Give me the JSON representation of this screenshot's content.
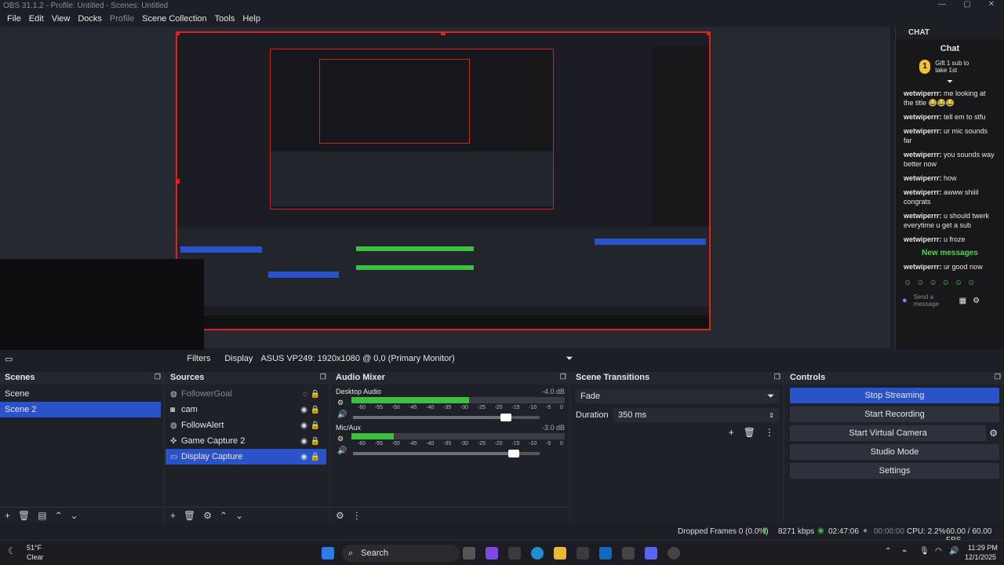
{
  "window": {
    "title": "OBS 31.1.2 - Profile: Untitled - Scenes: Untitled",
    "controls": [
      "—",
      "▢",
      "✕"
    ]
  },
  "menu": [
    "File",
    "Edit",
    "View",
    "Docks",
    "Profile",
    "Scene Collection",
    "Tools",
    "Help"
  ],
  "chat": {
    "dock_title": "CHAT",
    "title": "Chat",
    "gift_text": "Gift 1 sub to take 1st",
    "messages": [
      {
        "user": "wetwiperrr:",
        "text": "me looking at the title 😂😂😂"
      },
      {
        "user": "wetwiperrr:",
        "text": "tell em to stfu"
      },
      {
        "user": "wetwiperrr:",
        "text": "ur mic sounds far"
      },
      {
        "user": "wetwiperrr:",
        "text": "you sounds way better now"
      },
      {
        "user": "wetwiperrr:",
        "text": "how"
      },
      {
        "user": "wetwiperrr:",
        "text": "awww shiiil congrats"
      },
      {
        "user": "wetwiperrr:",
        "text": "u should twerk everytime u get a sub"
      },
      {
        "user": "wetwiperrr:",
        "text": "u froze"
      }
    ],
    "new_messages": "New messages",
    "last_message": {
      "user": "wetwiperrr:",
      "text": "ur good now"
    },
    "send_placeholder": "Send a message"
  },
  "source_toolbar": {
    "filters": "Filters",
    "display_label": "Display",
    "display_value": "ASUS VP249: 1920x1080 @ 0,0 (Primary Monitor)"
  },
  "scenes": {
    "title": "Scenes",
    "items": [
      "Scene",
      "Scene 2"
    ],
    "selected": 1
  },
  "sources": {
    "title": "Sources",
    "items": [
      {
        "name": "FollowerGoal",
        "icon": "browser-icon",
        "hidden": true
      },
      {
        "name": "cam",
        "icon": "camera-icon",
        "hidden": false
      },
      {
        "name": "FollowAlert",
        "icon": "browser-icon",
        "hidden": false
      },
      {
        "name": "Game Capture 2",
        "icon": "gamepad-icon",
        "hidden": false
      },
      {
        "name": "Display Capture",
        "icon": "monitor-icon",
        "hidden": false
      }
    ],
    "selected": 4
  },
  "audio_mixer": {
    "title": "Audio Mixer",
    "channels": [
      {
        "name": "Desktop Audio",
        "db": "-4.0 dB",
        "level": 0.55,
        "volume": 0.82
      },
      {
        "name": "Mic/Aux",
        "db": "-3.0 dB",
        "level": 0.2,
        "volume": 0.86
      }
    ],
    "ticks": [
      "-60",
      "-55",
      "-50",
      "-45",
      "-40",
      "-35",
      "-30",
      "-25",
      "-20",
      "-15",
      "-10",
      "-5",
      "0"
    ]
  },
  "transitions": {
    "title": "Scene Transitions",
    "type": "Fade",
    "duration_label": "Duration",
    "duration_value": "350 ms"
  },
  "controls": {
    "title": "Controls",
    "stop_streaming": "Stop Streaming",
    "start_recording": "Start Recording",
    "start_virtual_camera": "Start Virtual Camera",
    "studio_mode": "Studio Mode",
    "settings": "Settings"
  },
  "status": {
    "dropped_frames": "Dropped Frames 0 (0.0%)",
    "bitrate": "8271 kbps",
    "stream_time": "02:47:06",
    "rec_time": "00:00:00",
    "cpu": "CPU: 2.2%",
    "fps": "60.00 / 60.00 FPS"
  },
  "taskbar": {
    "weather_temp": "51°F",
    "weather_desc": "Clear",
    "search": "Search",
    "time": "11:29 PM",
    "date": "12/1/2025"
  },
  "colors": {
    "accent": "#2b53c9",
    "selection_red": "#d22222",
    "chat_green": "#4dd24d"
  }
}
